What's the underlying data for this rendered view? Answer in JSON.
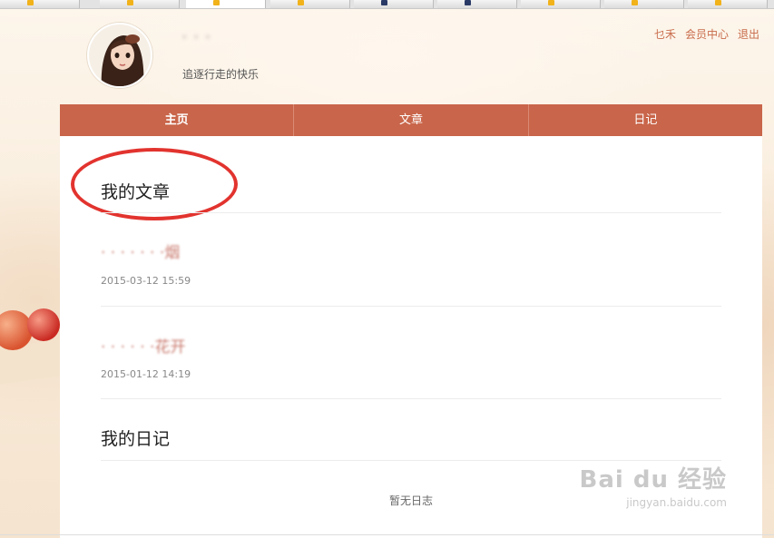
{
  "header": {
    "username": "‧ ‧ ‧",
    "motto": "追逐行走的快乐",
    "links": [
      "乜禾",
      "会员中心",
      "退出"
    ]
  },
  "nav": {
    "items": [
      {
        "label": "主页"
      },
      {
        "label": "文章"
      },
      {
        "label": "日记"
      }
    ]
  },
  "articles_section": {
    "title": "我的文章",
    "items": [
      {
        "title": "‧ ‧ ‧ ‧ ‧ ‧ ‧烟",
        "date": "2015-03-12 15:59"
      },
      {
        "title": "‧ ‧ ‧ ‧ ‧ ‧花开",
        "date": "2015-01-12 14:19"
      }
    ]
  },
  "diary_section": {
    "title": "我的日记",
    "empty_text": "暂无日志"
  },
  "watermark": {
    "main": "Bai du 经验",
    "sub": "jingyan.baidu.com"
  },
  "colors": {
    "nav_bg": "#c9654a",
    "link": "#c86b4a",
    "annotation_circle": "#e2332e"
  }
}
